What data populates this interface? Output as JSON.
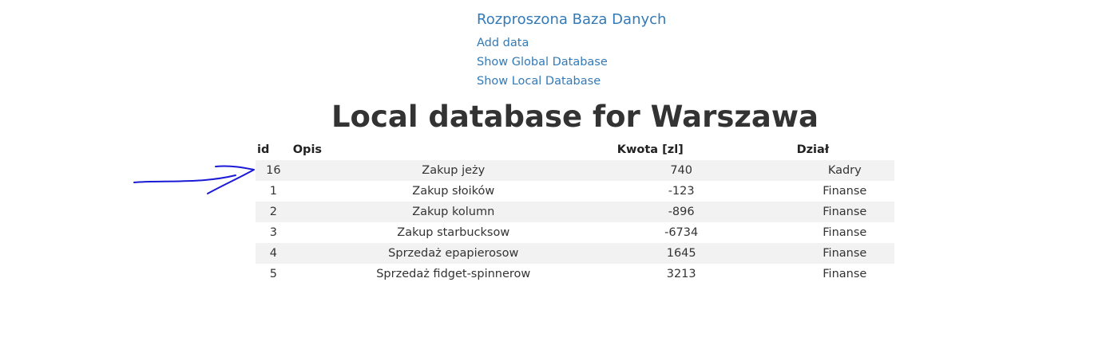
{
  "nav": {
    "brand": "Rozproszona Baza Danych",
    "links": [
      "Add data",
      "Show Global Database",
      "Show Local Database"
    ]
  },
  "page_title": "Local database for Warszawa",
  "table": {
    "headers": [
      "id",
      "Opis",
      "Kwota [zl]",
      "Dział"
    ],
    "rows": [
      [
        "16",
        "Zakup jeży",
        "740",
        "Kadry"
      ],
      [
        "1",
        "Zakup słoików",
        "-123",
        "Finanse"
      ],
      [
        "2",
        "Zakup kolumn",
        "-896",
        "Finanse"
      ],
      [
        "3",
        "Zakup starbucksow",
        "-6734",
        "Finanse"
      ],
      [
        "4",
        "Sprzedaż epapierosow",
        "1645",
        "Finanse"
      ],
      [
        "5",
        "Sprzedaż fidget-spinnerow",
        "3213",
        "Finanse"
      ]
    ]
  },
  "annotation": {
    "arrow_color": "#1a1ad6",
    "icon": "hand-drawn-arrow-icon"
  }
}
